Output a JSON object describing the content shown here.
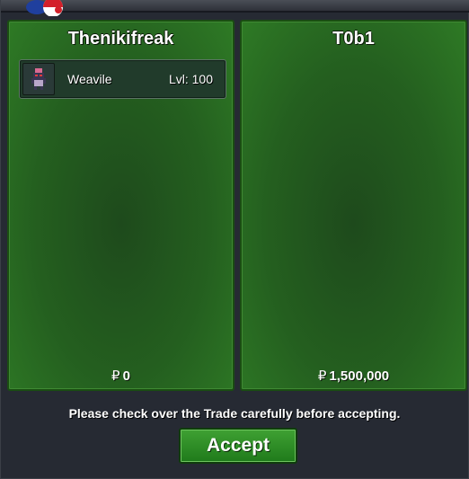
{
  "trade": {
    "left_panel": {
      "player_name": "Thenikifreak",
      "pokemon": [
        {
          "name": "Weavile",
          "level": "Lvl: 100",
          "sprite_icon": "weavile-sprite-icon"
        }
      ],
      "currency_symbol": "₽",
      "money": "0"
    },
    "right_panel": {
      "player_name": "T0b1",
      "pokemon": [],
      "currency_symbol": "₽",
      "money": "1,500,000"
    },
    "notice": "Please check over the Trade carefully before accepting.",
    "accept_label": "Accept"
  },
  "colors": {
    "panel_green": "#245f1f",
    "panel_border": "#1a4d12",
    "button_green": "#2f8f27",
    "window_bg": "#262a33"
  }
}
